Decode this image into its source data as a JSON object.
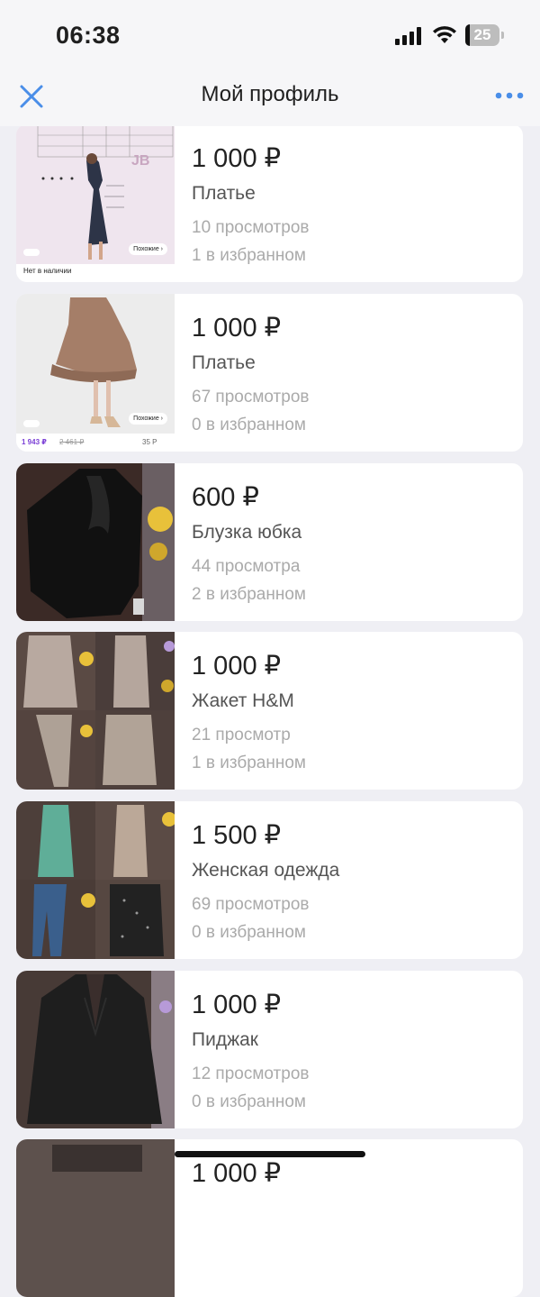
{
  "status_bar": {
    "time": "06:38",
    "battery": "25"
  },
  "header": {
    "title": "Мой профиль"
  },
  "listings": [
    {
      "price": "1 000 ₽",
      "name": "Платье",
      "views": "10 просмотров",
      "favorites": "1 в избранном",
      "thumb_caption": "Нет в наличии",
      "thumb_badge": "Похожие ›",
      "thumb_logo": "JB"
    },
    {
      "price": "1 000 ₽",
      "name": "Платье",
      "views": "67 просмотров",
      "favorites": "0 в избранном",
      "thumb_badge": "Похожие ›",
      "thumb_price": "1 943 ₽",
      "thumb_old_price": "2 461 ₽",
      "thumb_rating": "35 Р"
    },
    {
      "price": "600 ₽",
      "name": "Блузка юбка",
      "views": "44 просмотра",
      "favorites": "2 в избранном"
    },
    {
      "price": "1 000 ₽",
      "name": "Жакет H&M",
      "views": "21 просмотр",
      "favorites": "1 в избранном"
    },
    {
      "price": "1 500 ₽",
      "name": "Женская одежда",
      "views": "69 просмотров",
      "favorites": "0 в избранном"
    },
    {
      "price": "1 000 ₽",
      "name": "Пиджак",
      "views": "12 просмотров",
      "favorites": "0 в избранном"
    },
    {
      "price": "1 000 ₽"
    }
  ],
  "colors": {
    "accent": "#4a8ee8",
    "background": "#efeff4",
    "card": "#ffffff",
    "muted_text": "#aaaaaa"
  },
  "icons": [
    "close-icon",
    "more-icon",
    "signal-icon",
    "wifi-icon",
    "battery-icon"
  ]
}
